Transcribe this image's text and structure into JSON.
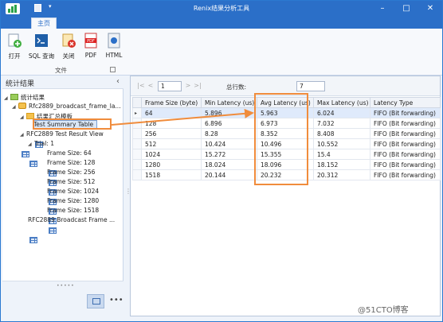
{
  "window": {
    "title": "Renix结果分析工具",
    "min_icon": "minimize-icon",
    "max_icon": "maximize-icon",
    "close_icon": "close-icon"
  },
  "ribbon": {
    "tab": "主页",
    "buttons": [
      {
        "label": "打开",
        "icon": "open-icon"
      },
      {
        "label": "SQL 查询",
        "icon": "sql-icon"
      },
      {
        "label": "关闭",
        "icon": "close-file-icon"
      },
      {
        "label": "PDF",
        "icon": "pdf-icon"
      },
      {
        "label": "HTML",
        "icon": "html-icon"
      }
    ],
    "group_label": "文件"
  },
  "left_panel": {
    "title": "统计结果",
    "collapse_glyph": "‹",
    "tree": [
      {
        "label": "统计结果",
        "toggle": "◢"
      },
      {
        "label": "Rfc2889_broadcast_frame_la...",
        "toggle": "◢"
      },
      {
        "label": "结果汇总模板",
        "toggle": "◢"
      },
      {
        "label": "Test Summary Table",
        "toggle": ""
      },
      {
        "label": "RFC2889 Test Result View",
        "toggle": "◢"
      },
      {
        "label": "Trial: 1",
        "toggle": "◢"
      },
      {
        "label": "Frame Size: 64",
        "toggle": ""
      },
      {
        "label": "Frame Size: 128",
        "toggle": ""
      },
      {
        "label": "Frame Size: 256",
        "toggle": ""
      },
      {
        "label": "Frame Size: 512",
        "toggle": ""
      },
      {
        "label": "Frame Size: 1024",
        "toggle": ""
      },
      {
        "label": "Frame Size: 1280",
        "toggle": ""
      },
      {
        "label": "Frame Size: 1518",
        "toggle": ""
      },
      {
        "label": "RFC2889 Broadcast Frame ...",
        "toggle": ""
      }
    ],
    "footer_more": "•••",
    "grip": "•••••"
  },
  "pager": {
    "first": "|<",
    "prev": "<",
    "page": "1",
    "next": ">",
    "last": ">|",
    "total_label": "总行数:",
    "total_value": "7"
  },
  "table": {
    "columns": [
      "Frame Size (byte)",
      "Min Latency (us)",
      "Avg Latency (us)",
      "Max Latency (us)",
      "Latency Type"
    ],
    "current_row_marker": "▸",
    "rows": [
      [
        "64",
        "5.896",
        "5.963",
        "6.024",
        "FIFO (Bit forwarding)"
      ],
      [
        "128",
        "6.896",
        "6.973",
        "7.032",
        "FIFO (Bit forwarding)"
      ],
      [
        "256",
        "8.28",
        "8.352",
        "8.408",
        "FIFO (Bit forwarding)"
      ],
      [
        "512",
        "10.424",
        "10.496",
        "10.552",
        "FIFO (Bit forwarding)"
      ],
      [
        "1024",
        "15.272",
        "15.355",
        "15.4",
        "FIFO (Bit forwarding)"
      ],
      [
        "1280",
        "18.024",
        "18.096",
        "18.152",
        "FIFO (Bit forwarding)"
      ],
      [
        "1518",
        "20.144",
        "20.232",
        "20.312",
        "FIFO (Bit forwarding)"
      ]
    ]
  },
  "watermark": "@51CTO博客",
  "colors": {
    "accent": "#2b6fc8",
    "highlight": "#f08c3c"
  }
}
